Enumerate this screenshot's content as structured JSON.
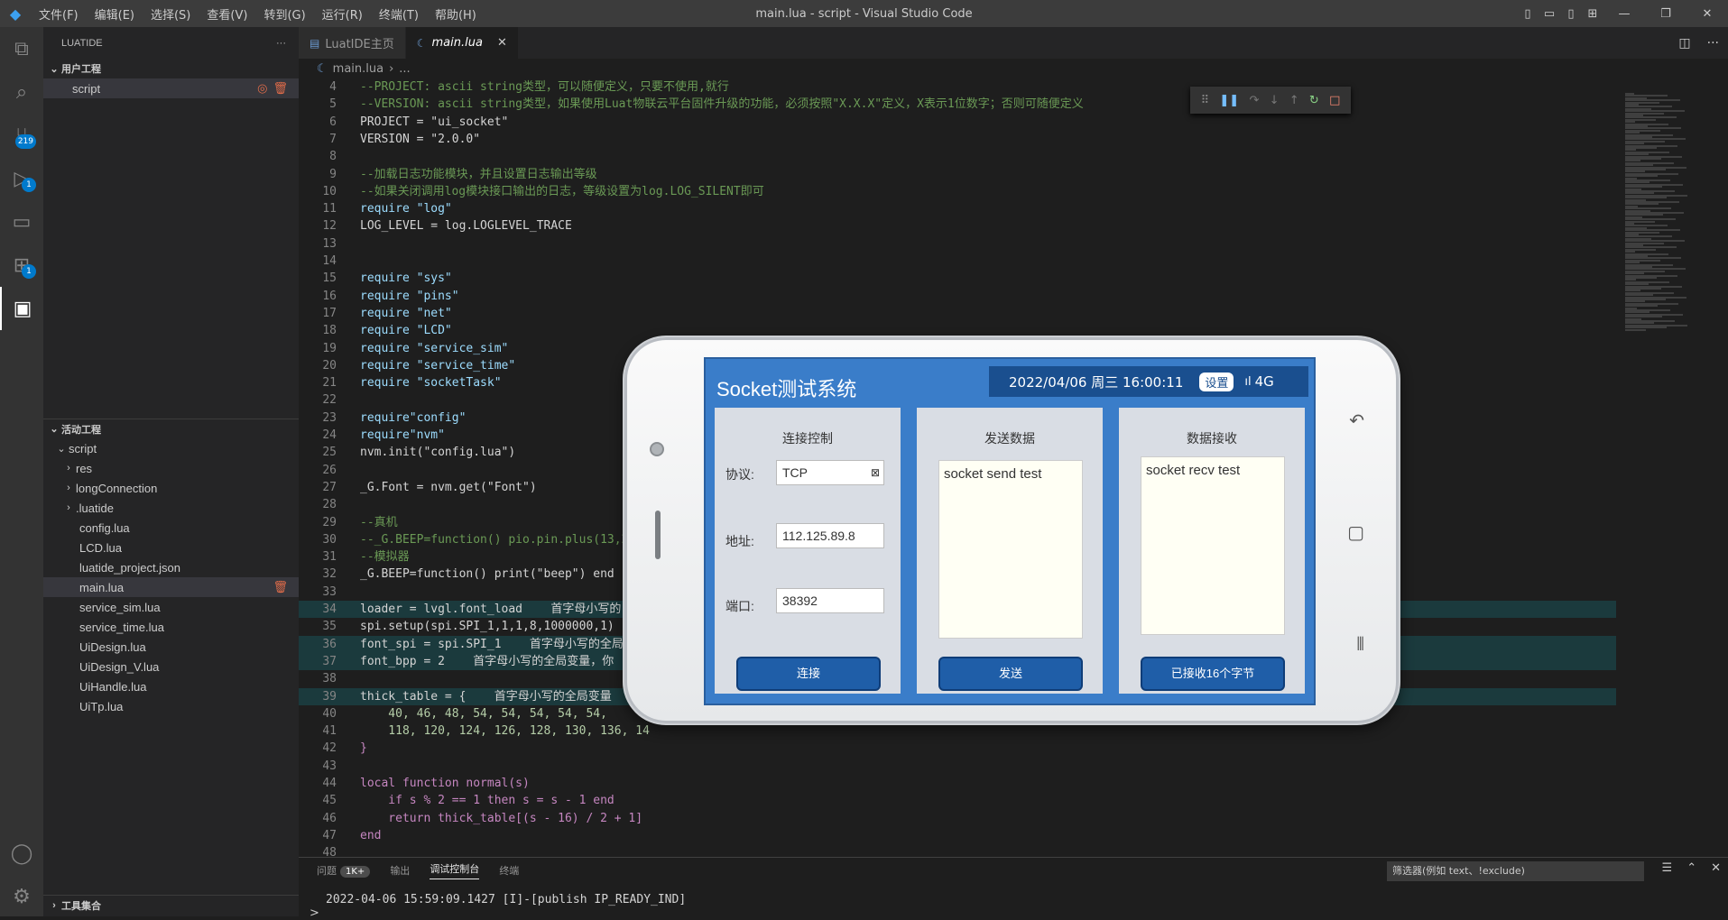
{
  "titlebar": {
    "menus": [
      "文件(F)",
      "编辑(E)",
      "选择(S)",
      "查看(V)",
      "转到(G)",
      "运行(R)",
      "终端(T)",
      "帮助(H)"
    ],
    "title": "main.lua - script - Visual Studio Code"
  },
  "activity": {
    "badge_scm": "219",
    "badge_debug": "1",
    "badge_ext": "1"
  },
  "sidebar": {
    "header": "LUATIDE",
    "user_section": "用户工程",
    "user_item": "script",
    "active_section": "活动工程",
    "root": "script",
    "items": [
      "res",
      "longConnection",
      ".luatide",
      "config.lua",
      "LCD.lua",
      "luatide_project.json",
      "main.lua",
      "service_sim.lua",
      "service_time.lua",
      "UiDesign.lua",
      "UiDesign_V.lua",
      "UiHandle.lua",
      "UiTp.lua"
    ],
    "tools_section": "工具集合"
  },
  "tabs": {
    "home": "LuatIDE主页",
    "main": "main.lua"
  },
  "breadcrumb": {
    "file": "main.lua",
    "rest": "..."
  },
  "code": [
    {
      "n": "4",
      "t": "--PROJECT: ascii string类型，可以随便定义，只要不使用,就行",
      "c": "c-com"
    },
    {
      "n": "5",
      "t": "--VERSION: ascii string类型，如果使用Luat物联云平台固件升级的功能，必须按照\"X.X.X\"定义，X表示1位数字；否则可随便定义",
      "c": "c-com"
    },
    {
      "n": "6",
      "t": "PROJECT = \"ui_socket\"",
      "c": ""
    },
    {
      "n": "7",
      "t": "VERSION = \"2.0.0\"",
      "c": ""
    },
    {
      "n": "8",
      "t": "",
      "c": ""
    },
    {
      "n": "9",
      "t": "--加载日志功能模块，并且设置日志输出等级",
      "c": "c-com"
    },
    {
      "n": "10",
      "t": "--如果关闭调用log模块接口输出的日志，等级设置为log.LOG_SILENT即可",
      "c": "c-com"
    },
    {
      "n": "11",
      "t": "require \"log\"",
      "c": ""
    },
    {
      "n": "12",
      "t": "LOG_LEVEL = log.LOGLEVEL_TRACE",
      "c": ""
    },
    {
      "n": "13",
      "t": "",
      "c": ""
    },
    {
      "n": "14",
      "t": "",
      "c": ""
    },
    {
      "n": "15",
      "t": "require \"sys\"",
      "c": ""
    },
    {
      "n": "16",
      "t": "require \"pins\"",
      "c": ""
    },
    {
      "n": "17",
      "t": "require \"net\"",
      "c": ""
    },
    {
      "n": "18",
      "t": "require \"LCD\"",
      "c": ""
    },
    {
      "n": "19",
      "t": "require \"service_sim\"",
      "c": ""
    },
    {
      "n": "20",
      "t": "require \"service_time\"",
      "c": ""
    },
    {
      "n": "21",
      "t": "require \"socketTask\"",
      "c": ""
    },
    {
      "n": "22",
      "t": "",
      "c": ""
    },
    {
      "n": "23",
      "t": "require\"config\"",
      "c": ""
    },
    {
      "n": "24",
      "t": "require\"nvm\"",
      "c": ""
    },
    {
      "n": "25",
      "t": "nvm.init(\"config.lua\")",
      "c": ""
    },
    {
      "n": "26",
      "t": "",
      "c": ""
    },
    {
      "n": "27",
      "t": "_G.Font = nvm.get(\"Font\")",
      "c": ""
    },
    {
      "n": "28",
      "t": "",
      "c": ""
    },
    {
      "n": "29",
      "t": "--真机",
      "c": "c-com"
    },
    {
      "n": "30",
      "t": "--_G.BEEP=function() pio.pin.plus(13,2",
      "c": "c-com"
    },
    {
      "n": "31",
      "t": "--模拟器",
      "c": "c-com"
    },
    {
      "n": "32",
      "t": "_G.BEEP=function() print(\"beep\") end",
      "c": ""
    },
    {
      "n": "33",
      "t": "",
      "c": ""
    },
    {
      "n": "34",
      "t": "loader = lvgl.font_load    首字母小写的",
      "c": "",
      "hl": true
    },
    {
      "n": "35",
      "t": "spi.setup(spi.SPI_1,1,1,8,1000000,1)",
      "c": ""
    },
    {
      "n": "36",
      "t": "font_spi = spi.SPI_1    首字母小写的全局",
      "c": "",
      "hl": true
    },
    {
      "n": "37",
      "t": "font_bpp = 2    首字母小写的全局变量，你",
      "c": "",
      "hl": true
    },
    {
      "n": "38",
      "t": "",
      "c": ""
    },
    {
      "n": "39",
      "t": "thick_table = {    首字母小写的全局变量",
      "c": "",
      "hl": true
    },
    {
      "n": "40",
      "t": "    40, 46, 48, 54, 54, 54, 54, 54,",
      "c": "c-num"
    },
    {
      "n": "41",
      "t": "    118, 120, 124, 126, 128, 130, 136, 14",
      "c": "c-num"
    },
    {
      "n": "42",
      "t": "}",
      "c": ""
    },
    {
      "n": "43",
      "t": "",
      "c": ""
    },
    {
      "n": "44",
      "t": "local function normal(s)",
      "c": ""
    },
    {
      "n": "45",
      "t": "    if s % 2 == 1 then s = s - 1 end",
      "c": ""
    },
    {
      "n": "46",
      "t": "    return thick_table[(s - 16) / 2 + 1]",
      "c": ""
    },
    {
      "n": "47",
      "t": "end",
      "c": ""
    },
    {
      "n": "48",
      "t": "",
      "c": ""
    }
  ],
  "panel": {
    "tabs": [
      "问题",
      "输出",
      "调试控制台",
      "终端"
    ],
    "badge": "1K+",
    "filter": "筛选器(例如 text、!exclude)",
    "output": "2022-04-06 15:59:09.1427 [I]-[publish IP_READY_IND]",
    "prompt": ">"
  },
  "phone": {
    "title": "Socket测试系统",
    "datetime": "2022/04/06 周三 16:00:11",
    "settings": "设置",
    "network": "4G",
    "panel1": {
      "title": "连接控制",
      "proto_label": "协议:",
      "proto": "TCP",
      "addr_label": "地址:",
      "addr": "112.125.89.8",
      "port_label": "端口:",
      "port": "38392",
      "btn": "连接"
    },
    "panel2": {
      "title": "发送数据",
      "text": "socket send test",
      "btn": "发送"
    },
    "panel3": {
      "title": "数据接收",
      "text": "socket recv test",
      "btn": "已接收16个字节"
    }
  }
}
